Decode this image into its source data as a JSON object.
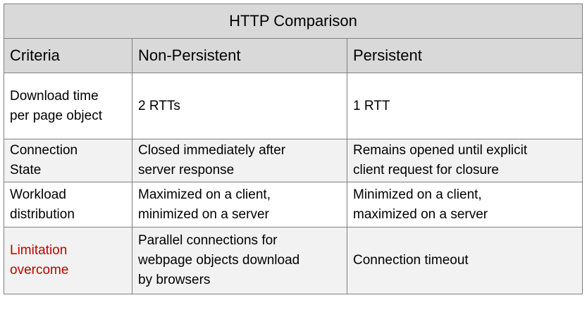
{
  "table": {
    "title": "HTTP Comparison",
    "headers": [
      "Criteria",
      "Non-Persistent",
      "Persistent"
    ],
    "rows": [
      {
        "criteria": "Download time\nper page object",
        "non_persistent": "2 RTTs",
        "persistent": "1 RTT"
      },
      {
        "criteria": "Connection\nState",
        "non_persistent": "Closed immediately after\nserver response",
        "persistent": "Remains opened until explicit\nclient request for closure"
      },
      {
        "criteria": "Workload\ndistribution",
        "non_persistent": "Maximized on a client,\nminimized on a server",
        "persistent": "Minimized on a client,\nmaximized on a server"
      },
      {
        "criteria": "Limitation\novercome",
        "non_persistent": "Parallel connections for\nwebpage objects download\nby browsers",
        "persistent": "Connection timeout"
      }
    ]
  },
  "colors": {
    "header_bg": "#d9d9d9",
    "alt_row_bg": "#f2f2f2",
    "highlight_text": "#c00000",
    "border": "#7f7f7f"
  }
}
